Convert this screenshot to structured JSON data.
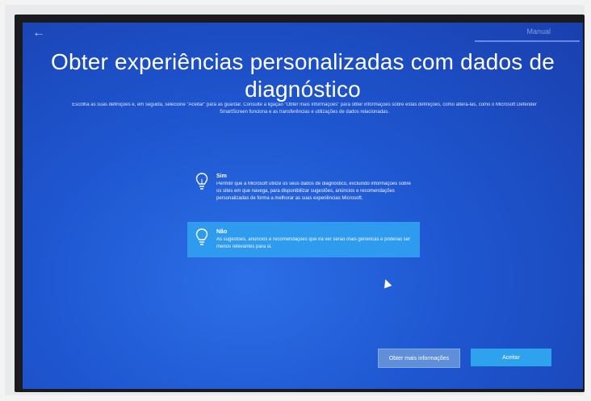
{
  "topbar": {
    "right_text": "Manual"
  },
  "header": {
    "title": "Obter experiências personalizadas com dados de diagnóstico",
    "description": "Escolha as suas definições e, em seguida, selecione \"Aceitar\" para as guardar. Consulte a ligação \"Obter mais informações\" para obter informações sobre estas definições, como alterá-las, como o Microsoft Defender SmartScreen funciona e as transferências e utilizações de dados relacionadas."
  },
  "options": [
    {
      "title": "Sim",
      "text": "Permitir que a Microsoft utilize os seus dados de diagnóstico, excluindo informações sobre os sites em que navega, para disponibilizar sugestões, anúncios e recomendações personalizadas de forma a melhorar as suas experiências Microsoft.",
      "selected": false
    },
    {
      "title": "Não",
      "text": "As sugestões, anúncios e recomendações que irá ver serão mais genéricas e poderão ser menos relevantes para si.",
      "selected": true
    }
  ],
  "buttons": {
    "more_info": "Obter mais informações",
    "accept": "Aceitar"
  },
  "colors": {
    "background": "#1e56d0",
    "selected_option": "#2f9bee",
    "accept_button": "#2fa2ee"
  },
  "icons": {
    "back": "back-arrow-icon",
    "option": "lightbulb-icon"
  }
}
